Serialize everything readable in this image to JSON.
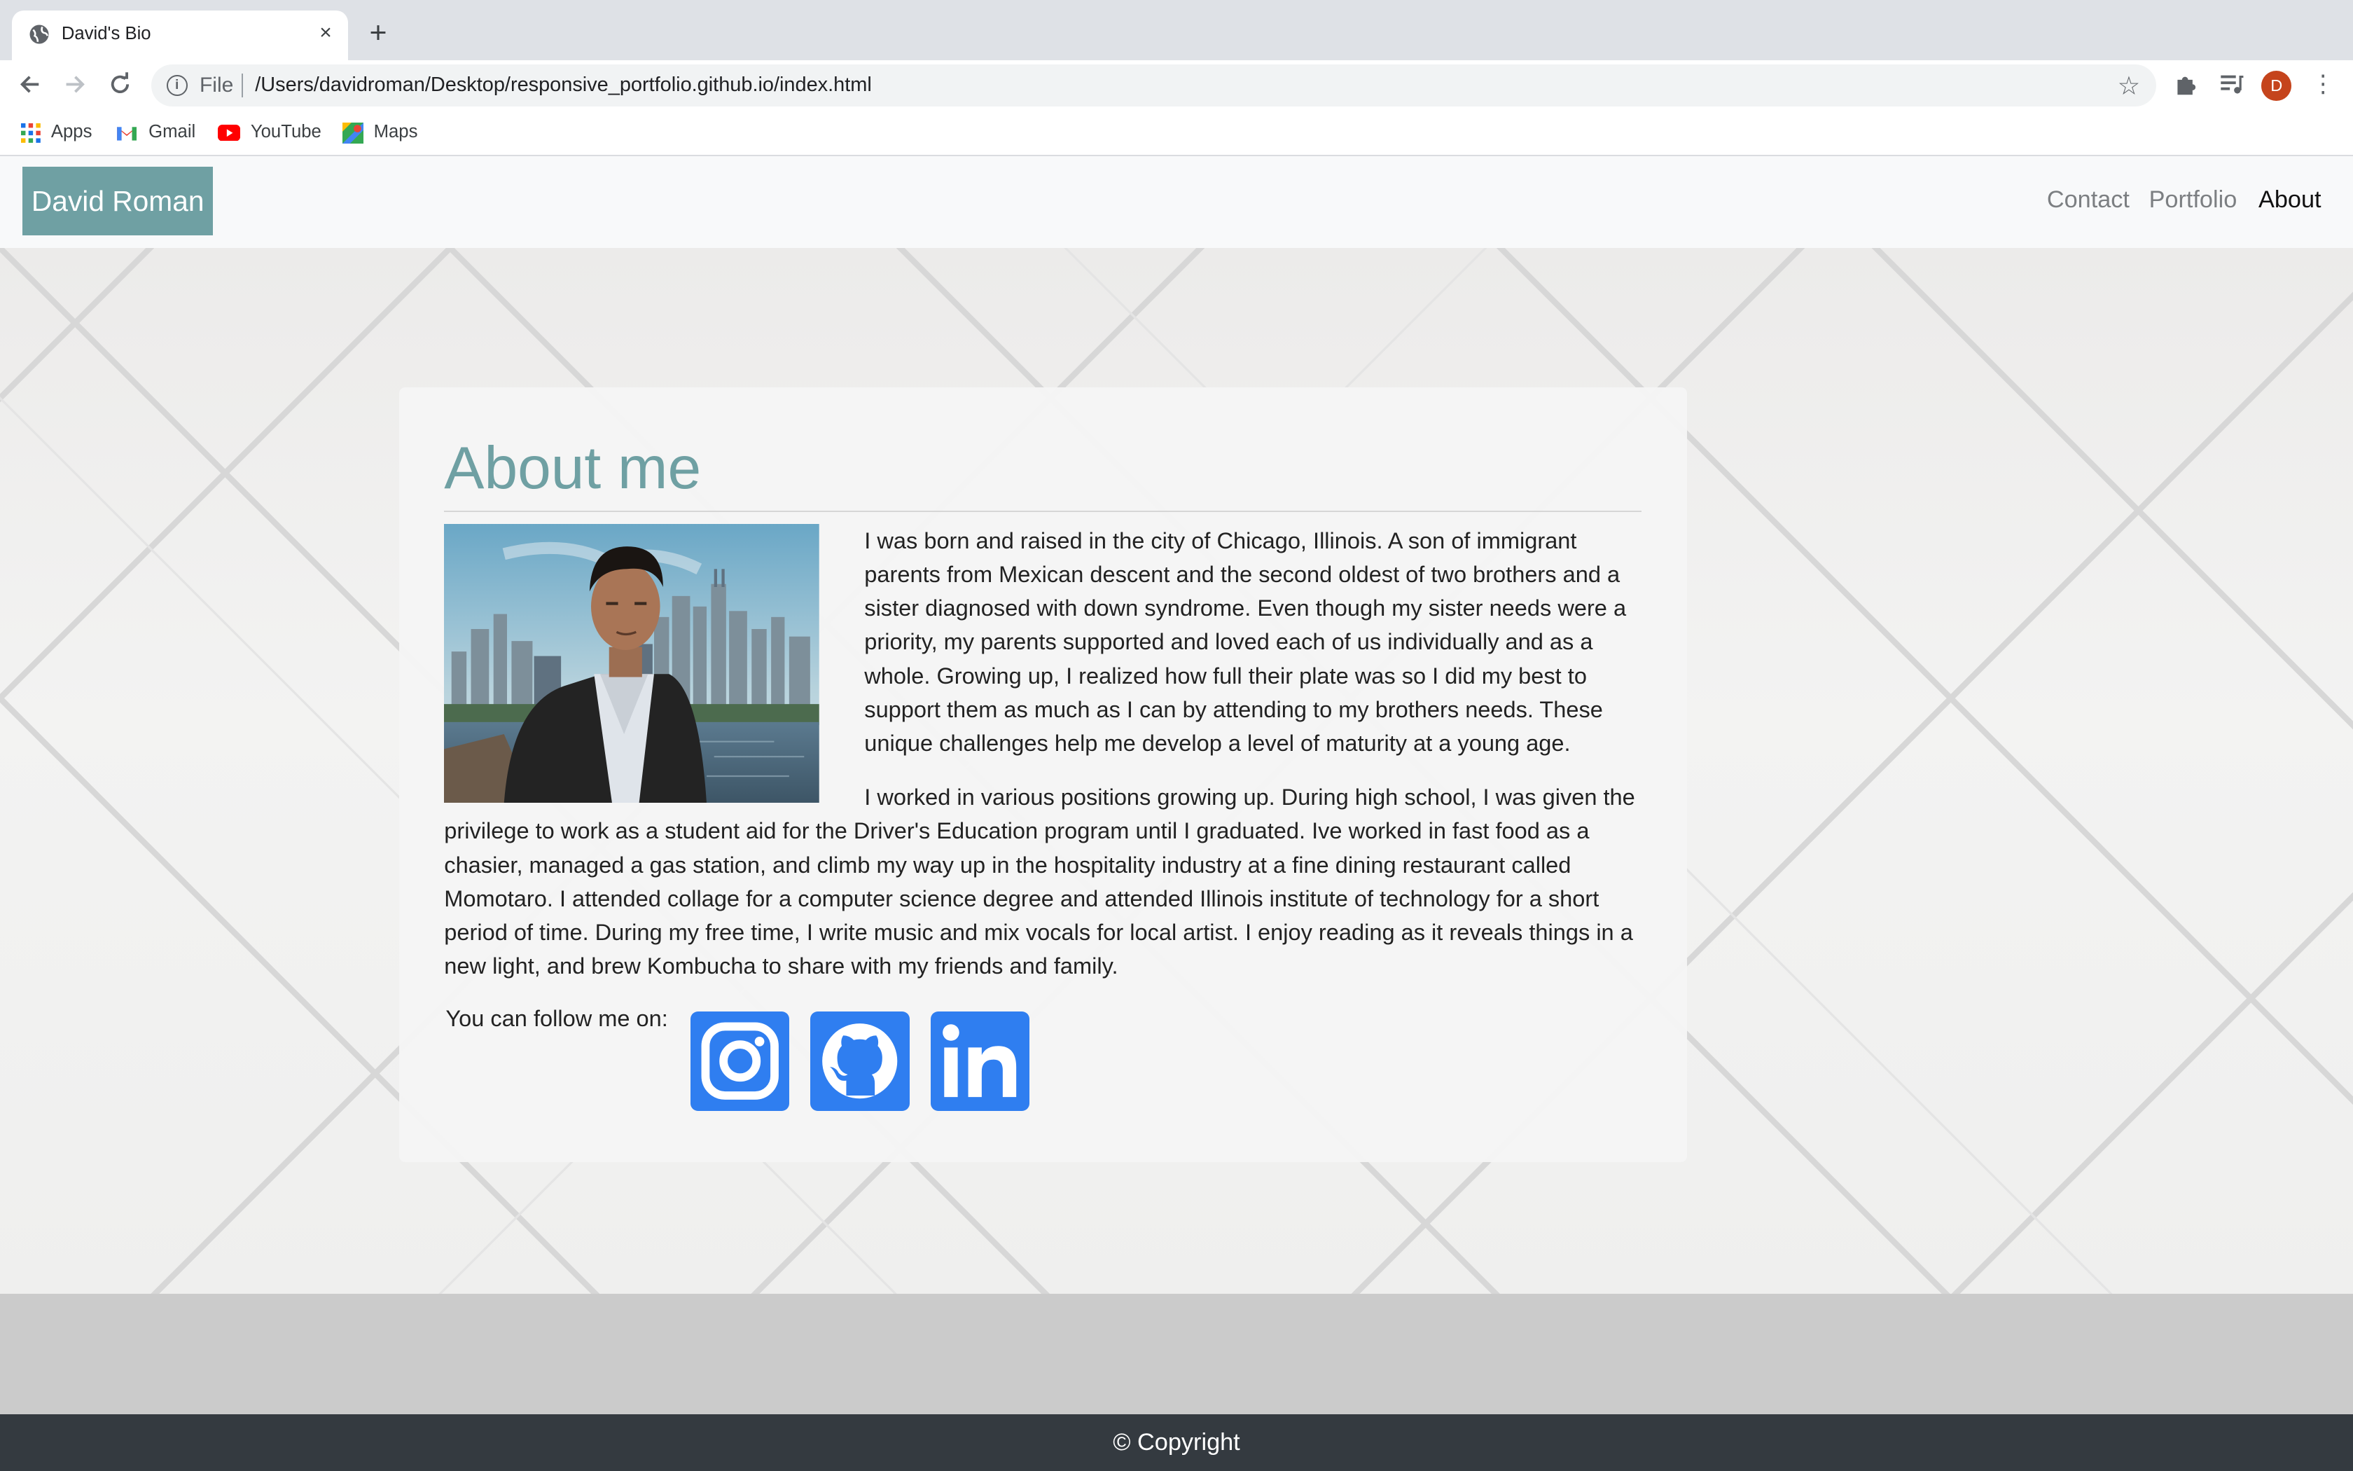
{
  "browser": {
    "tab_title": "David's Bio",
    "tab_close": "×",
    "new_tab": "+",
    "omnibox_scheme": "File",
    "url": "/Users/davidroman/Desktop/responsive_portfolio.github.io/index.html",
    "avatar_initial": "D",
    "bookmarks": [
      {
        "label": "Apps",
        "icon": "apps-grid-icon"
      },
      {
        "label": "Gmail",
        "icon": "gmail-icon"
      },
      {
        "label": "YouTube",
        "icon": "youtube-icon"
      },
      {
        "label": "Maps",
        "icon": "maps-icon"
      }
    ]
  },
  "navbar": {
    "brand": "David Roman",
    "links": [
      "Contact",
      "Portfolio",
      "About"
    ],
    "active": "About"
  },
  "about": {
    "title": "About me",
    "paragraph1": "I was born and raised in the city of Chicago, Illinois. A son of immigrant parents from Mexican descent and the second oldest of two brothers and a sister diagnosed with down syndrome. Even though my sister needs were a priority, my parents supported and loved each of us individually and as a whole. Growing up, I realized how full their plate was so I did my best to support them as much as I can by attending to my brothers needs. These unique challenges help me develop a level of maturity at a young age.",
    "paragraph2": "I worked in various positions growing up. During high school, I was given the privilege to work as a student aid for the Driver's Education program until I graduated. Ive worked in fast food as a chasier, managed a gas station, and climb my way up in the hospitality industry at a fine dining restaurant called Momotaro. I attended collage for a computer science degree and attended Illinois institute of technology for a short period of time. During my free time, I write music and mix vocals for local artist. I enjoy reading as it reveals things in a new light, and brew Kombucha to share with my friends and family.",
    "follow_label": "You can follow me on:",
    "social": [
      "instagram-icon",
      "github-icon",
      "linkedin-icon"
    ]
  },
  "footer": {
    "copyright": "© Copyright"
  },
  "colors": {
    "brand": "#6fa0a3",
    "social": "#2f7ef0",
    "footer": "#343a40"
  }
}
